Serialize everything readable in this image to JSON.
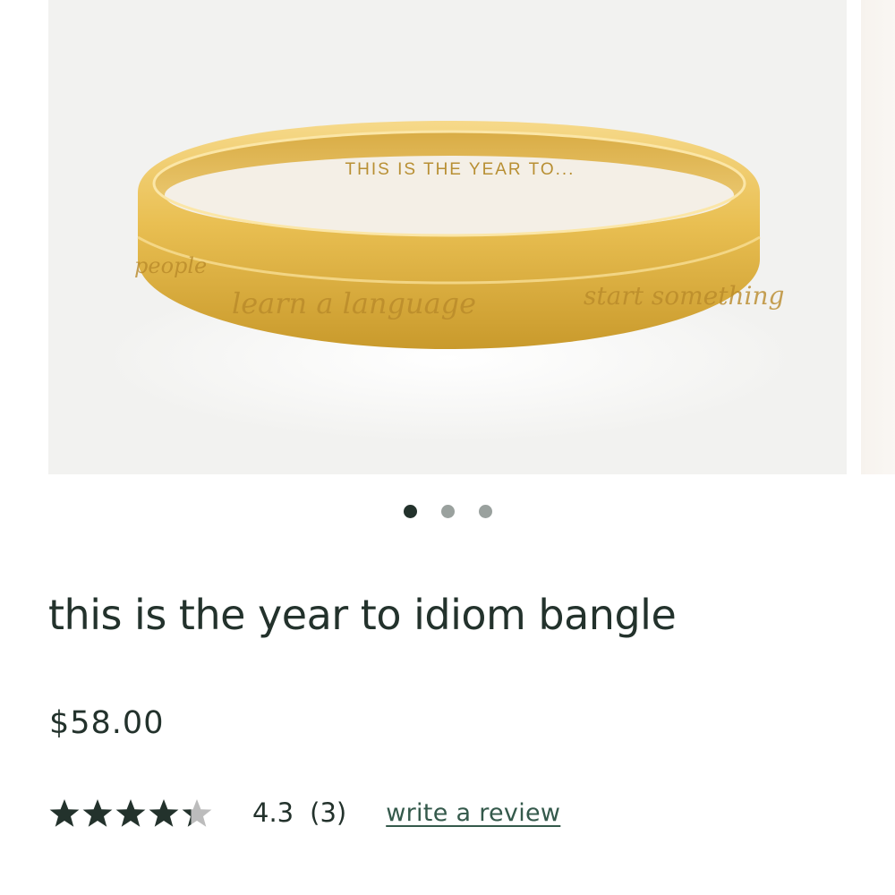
{
  "gallery": {
    "image_engraving_inner": "THIS IS THE YEAR TO...",
    "image_engraving_outer": [
      "people",
      "learn a language",
      "start something"
    ],
    "slide_count": 3,
    "active_slide": 1
  },
  "product": {
    "title": "this is the year to idiom bangle",
    "price": "$58.00"
  },
  "rating": {
    "value": "4.3",
    "stars": 4.3,
    "max_stars": 5,
    "count": "(3)",
    "write_review_label": "write a review"
  },
  "colors": {
    "text": "#23322c",
    "link": "#34594b",
    "star_filled": "#23322c",
    "star_empty": "#bcbcbc",
    "dot_inactive": "#9aa19e"
  },
  "icons": {
    "star": "star-icon"
  }
}
